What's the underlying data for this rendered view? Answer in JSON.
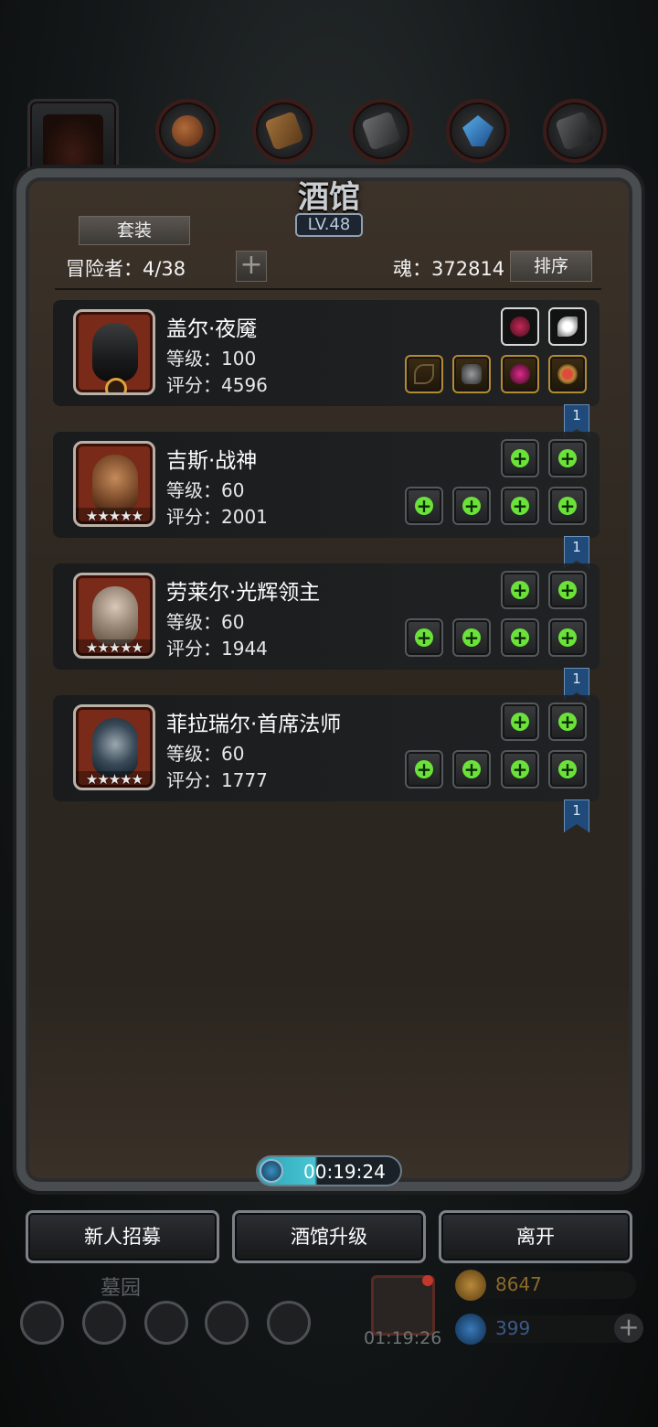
{
  "top_tabs": [
    {
      "name": "hero-tab",
      "icon": "hooded-figure-icon"
    },
    {
      "name": "meat-tab",
      "icon": "meat-icon"
    },
    {
      "name": "wood-tab",
      "icon": "wood-icon"
    },
    {
      "name": "iron-tab",
      "icon": "iron-icon"
    },
    {
      "name": "crystal-tab",
      "icon": "crystal-icon"
    },
    {
      "name": "stone-tab",
      "icon": "stone-icon"
    }
  ],
  "panel": {
    "title": "酒馆",
    "level": "LV.48",
    "set_button": "套装",
    "adventurers": "冒险者：4/38",
    "soul": "魂：372814",
    "sort_button": "排序"
  },
  "heroes": [
    {
      "name": "盖尔·夜魇",
      "level": "等级：100",
      "score": "评分：4596",
      "stars": "",
      "bookmark": "1",
      "portrait_color": "#7a2a18",
      "equipped": true
    },
    {
      "name": "吉斯·战神",
      "level": "等级：60",
      "score": "评分：2001",
      "stars": "★★★★★",
      "bookmark": "1",
      "portrait_color": "#7a2a18",
      "equipped": false
    },
    {
      "name": "劳莱尔·光辉领主",
      "level": "等级：60",
      "score": "评分：1944",
      "stars": "★★★★★",
      "bookmark": "1",
      "portrait_color": "#7a2a18",
      "equipped": false
    },
    {
      "name": "菲拉瑞尔·首席法师",
      "level": "等级：60",
      "score": "评分：1777",
      "stars": "★★★★★",
      "bookmark": "1",
      "portrait_color": "#7a2a18",
      "equipped": false
    }
  ],
  "timer": "00:19:24",
  "buttons": {
    "recruit": "新人招募",
    "upgrade": "酒馆升级",
    "leave": "离开"
  },
  "hud": {
    "area_label": "墓园",
    "gift_timer": "01:19:26",
    "gold": "8647",
    "gems": "399",
    "plus": "+"
  },
  "colors": {
    "accent_green": "#6be13a",
    "timer_cyan": "#48c4d2",
    "bookmark_blue": "#1f4a7a",
    "gold_text": "#8a6a2a",
    "gem_text": "#3a5a8a"
  }
}
